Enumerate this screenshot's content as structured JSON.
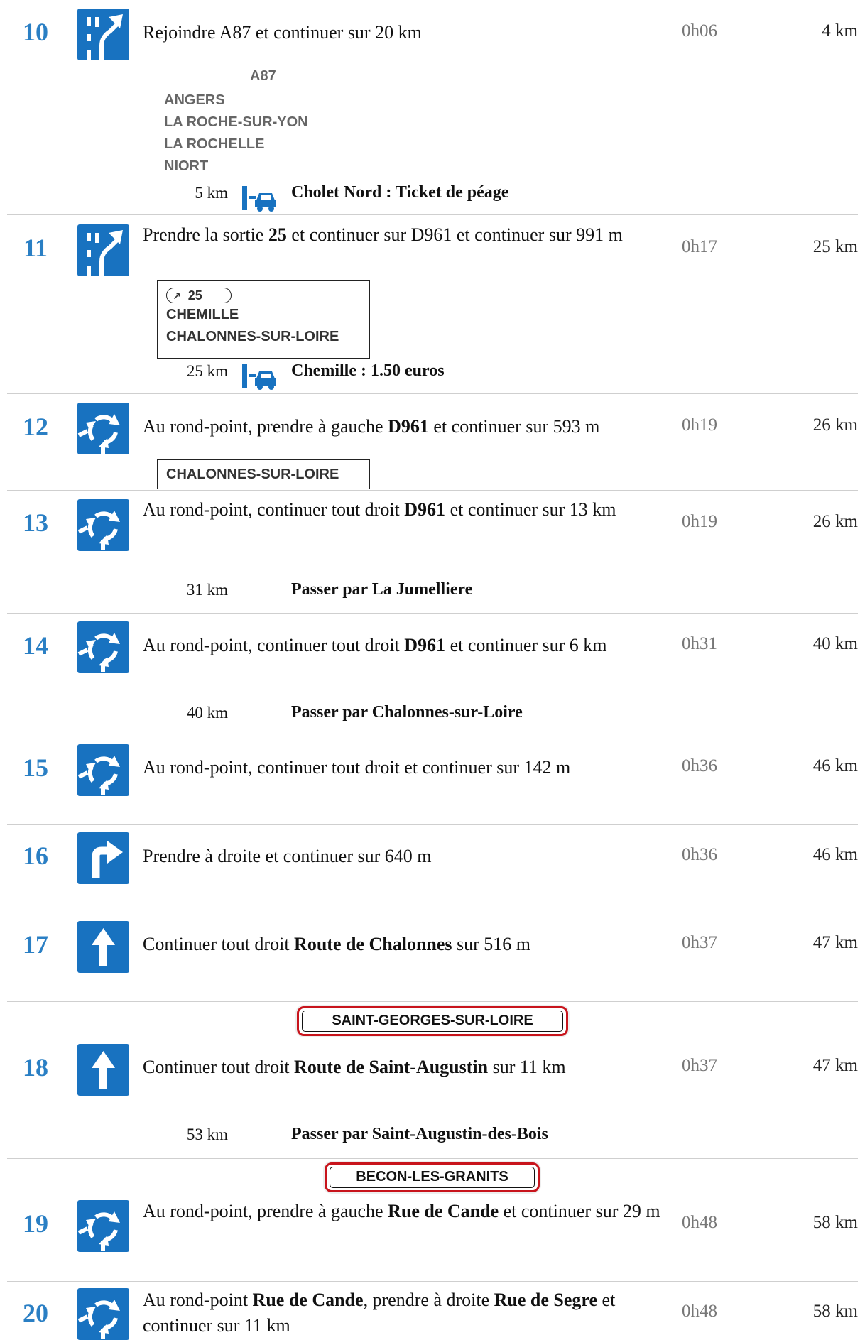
{
  "colors": {
    "step_number": "#2a7fc4",
    "icon_bg": "#1872c0",
    "town_border": "#c8141c"
  },
  "steps": [
    {
      "number": "10",
      "icon": "merge-left-icon",
      "instruction": [
        {
          "t": "Rejoindre A87 et continuer sur 20 km",
          "b": false
        }
      ],
      "time": "0h06",
      "distance": "4 km",
      "sign_lines": [
        "A87",
        "ANGERS",
        "LA ROCHE-SUR-YON",
        "LA ROCHELLE",
        "NIORT"
      ],
      "sub": {
        "distance": "5 km",
        "text": "Cholet Nord : Ticket de péage",
        "icon": "toll-icon"
      }
    },
    {
      "number": "11",
      "icon": "merge-left-icon",
      "instruction": [
        {
          "t": "Prendre la sortie ",
          "b": false
        },
        {
          "t": "25",
          "b": true
        },
        {
          "t": " et continuer sur D961 et continuer sur 991 m",
          "b": false
        }
      ],
      "time": "0h17",
      "distance": "25 km",
      "exit_number": "25",
      "sign_lines": [
        "CHEMILLE",
        "CHALONNES-SUR-LOIRE"
      ],
      "sub": {
        "distance": "25 km",
        "text": "Chemille : 1.50 euros",
        "icon": "toll-icon"
      }
    },
    {
      "number": "12",
      "icon": "roundabout-icon",
      "instruction": [
        {
          "t": "Au rond-point, prendre à gauche ",
          "b": false
        },
        {
          "t": "D961",
          "b": true
        },
        {
          "t": " et continuer sur 593 m",
          "b": false
        }
      ],
      "time": "0h19",
      "distance": "26 km",
      "sign_lines": [
        "CHALONNES-SUR-LOIRE"
      ]
    },
    {
      "number": "13",
      "icon": "roundabout-icon",
      "instruction": [
        {
          "t": "Au rond-point, continuer tout droit ",
          "b": false
        },
        {
          "t": "D961",
          "b": true
        },
        {
          "t": " et continuer sur 13 km",
          "b": false
        }
      ],
      "time": "0h19",
      "distance": "26 km",
      "sub": {
        "distance": "31 km",
        "text": "Passer par La Jumelliere"
      }
    },
    {
      "number": "14",
      "icon": "roundabout-icon",
      "instruction": [
        {
          "t": "Au rond-point, continuer tout droit ",
          "b": false
        },
        {
          "t": "D961",
          "b": true
        },
        {
          "t": " et continuer sur 6 km",
          "b": false
        }
      ],
      "time": "0h31",
      "distance": "40 km",
      "sub": {
        "distance": "40 km",
        "text": "Passer par Chalonnes-sur-Loire"
      }
    },
    {
      "number": "15",
      "icon": "roundabout-icon",
      "instruction": [
        {
          "t": "Au rond-point, continuer tout droit et continuer sur 142 m",
          "b": false
        }
      ],
      "time": "0h36",
      "distance": "46 km"
    },
    {
      "number": "16",
      "icon": "turn-right-icon",
      "instruction": [
        {
          "t": "Prendre à droite et continuer sur 640 m",
          "b": false
        }
      ],
      "time": "0h36",
      "distance": "46 km"
    },
    {
      "number": "17",
      "icon": "straight-icon",
      "instruction": [
        {
          "t": "Continuer tout droit ",
          "b": false
        },
        {
          "t": "Route de Chalonnes",
          "b": true
        },
        {
          "t": " sur 516 m",
          "b": false
        }
      ],
      "time": "0h37",
      "distance": "47 km"
    },
    {
      "number": "18",
      "icon": "straight-icon",
      "town_sign": "SAINT-GEORGES-SUR-LOIRE",
      "instruction": [
        {
          "t": "Continuer tout droit ",
          "b": false
        },
        {
          "t": "Route de Saint-Augustin",
          "b": true
        },
        {
          "t": " sur 11 km",
          "b": false
        }
      ],
      "time": "0h37",
      "distance": "47 km",
      "sub": {
        "distance": "53 km",
        "text": "Passer par Saint-Augustin-des-Bois"
      }
    },
    {
      "number": "19",
      "icon": "roundabout-icon",
      "town_sign": "BECON-LES-GRANITS",
      "instruction": [
        {
          "t": "Au rond-point, prendre à gauche ",
          "b": false
        },
        {
          "t": "Rue de Cande",
          "b": true
        },
        {
          "t": " et continuer sur 29 m",
          "b": false
        }
      ],
      "time": "0h48",
      "distance": "58 km"
    },
    {
      "number": "20",
      "icon": "roundabout-icon",
      "instruction": [
        {
          "t": "Au rond-point ",
          "b": false
        },
        {
          "t": "Rue de Cande",
          "b": true
        },
        {
          "t": ", prendre à droite ",
          "b": false
        },
        {
          "t": "Rue de Segre",
          "b": true
        },
        {
          "t": " et continuer sur 11 km",
          "b": false
        }
      ],
      "time": "0h48",
      "distance": "58 km"
    }
  ]
}
